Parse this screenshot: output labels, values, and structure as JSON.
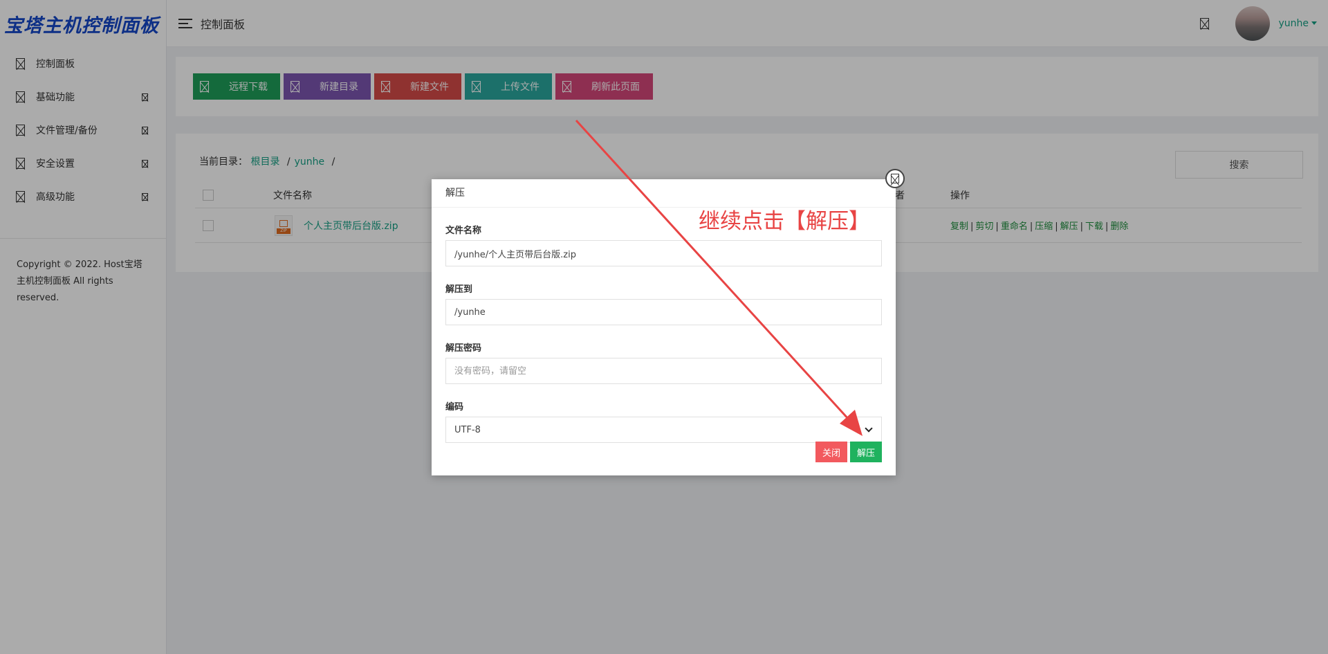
{
  "app": {
    "logo": "宝塔主机控制面板",
    "header_title": "控制面板",
    "user_name": "yunhe"
  },
  "sidebar": {
    "items": [
      {
        "label": "控制面板",
        "icon": "dashboard-icon"
      },
      {
        "label": "基础功能",
        "icon": "basic-functions-icon"
      },
      {
        "label": "文件管理/备份",
        "icon": "file-manager-icon"
      },
      {
        "label": "安全设置",
        "icon": "security-icon"
      },
      {
        "label": "高级功能",
        "icon": "advanced-icon"
      }
    ],
    "copyright": "Copyright © 2022. Host宝塔主机控制面板 All rights reserved."
  },
  "toolbar": {
    "buttons": [
      {
        "label": "远程下载"
      },
      {
        "label": "新建目录"
      },
      {
        "label": "新建文件"
      },
      {
        "label": "上传文件"
      },
      {
        "label": "刷新此页面"
      }
    ]
  },
  "file_list": {
    "breadcrumb_prefix": "当前目录：",
    "breadcrumb": [
      "根目录",
      "yunhe"
    ],
    "breadcrumb_sep": "/",
    "search_label": "搜索",
    "columns": {
      "name": "文件名称",
      "owner": "者",
      "ops": "操作"
    },
    "rows": [
      {
        "name": "个人主页带后台版.zip",
        "icon_tag": "ZIP",
        "ops": [
          "复制",
          "剪切",
          "重命名",
          "压缩",
          "解压",
          "下载",
          "删除"
        ]
      }
    ]
  },
  "modal": {
    "title": "解压",
    "fields": {
      "filename_label": "文件名称",
      "filename_value": "/yunhe/个人主页带后台版.zip",
      "extract_to_label": "解压到",
      "extract_to_value": "/yunhe",
      "password_label": "解压密码",
      "password_placeholder": "没有密码，请留空",
      "encoding_label": "编码",
      "encoding_value": "UTF-8"
    },
    "close_label": "关闭",
    "confirm_label": "解压"
  },
  "annotation": {
    "text": "继续点击【解压】",
    "color": "#e84444"
  },
  "colors": {
    "brand_blue": "#1446c8",
    "link_green": "#16a085",
    "ok_green": "#1fb25e",
    "danger_red": "#f2595e"
  }
}
